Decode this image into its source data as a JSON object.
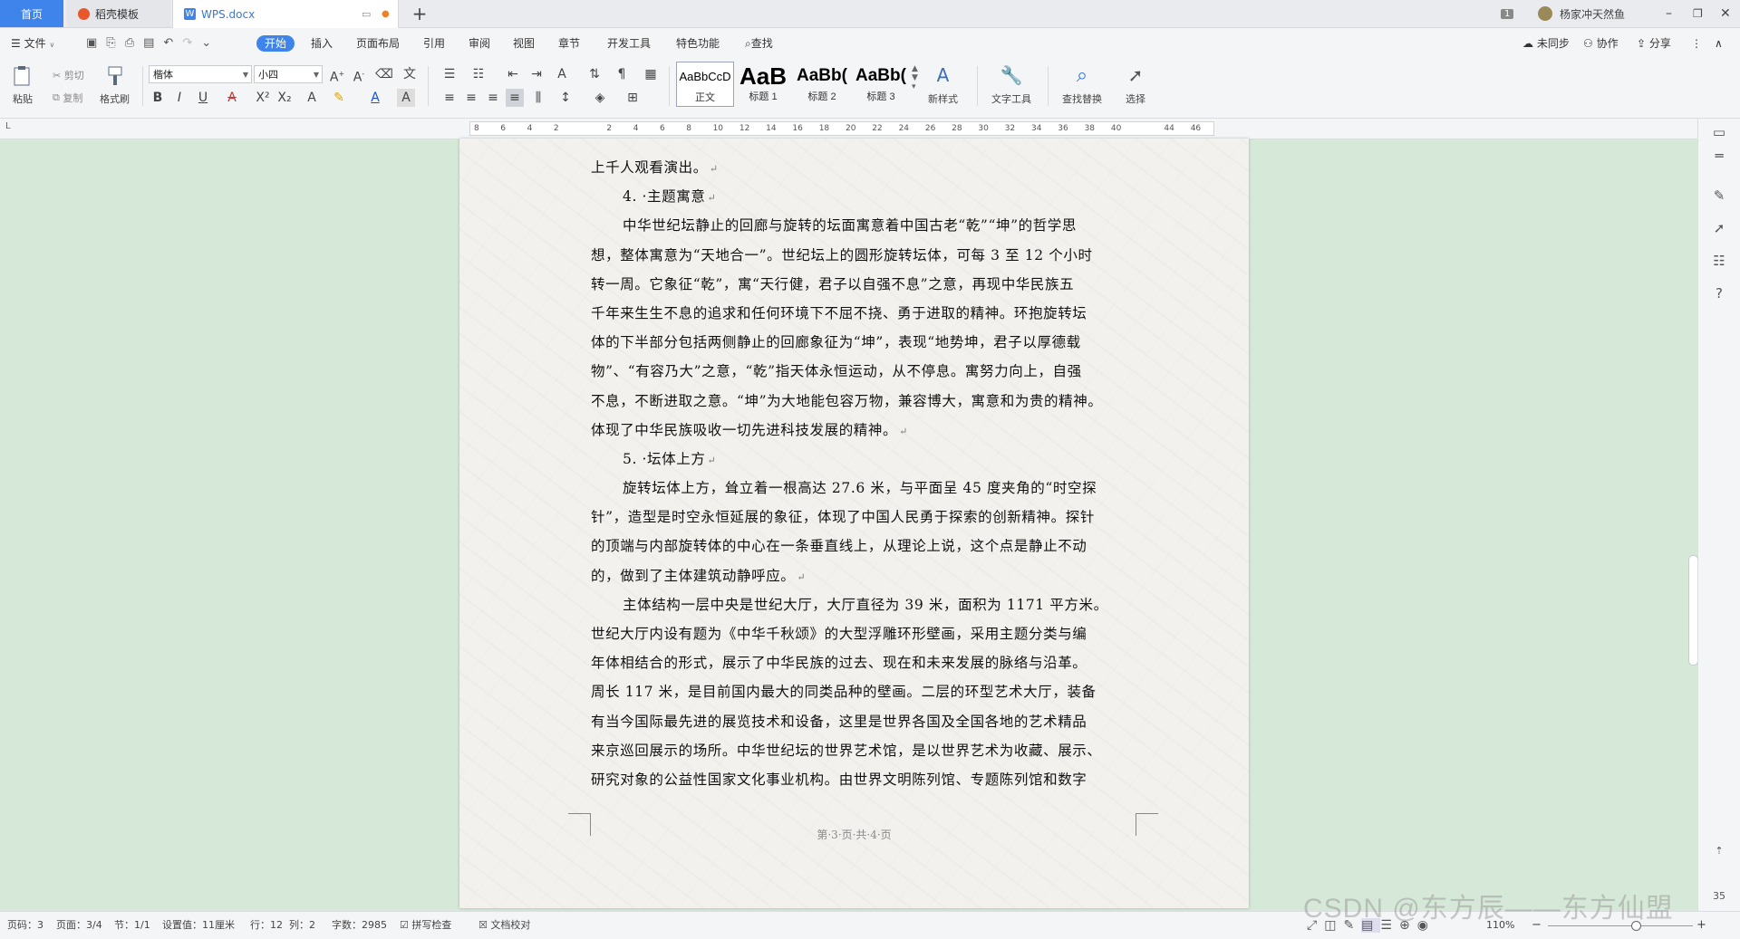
{
  "tabs": {
    "home": "首页",
    "template": "稻壳模板",
    "doc": "WPS.docx",
    "new_tab": "+"
  },
  "window": {
    "badge": "1",
    "user": "杨家冲天然鱼"
  },
  "menu": {
    "file": "文件",
    "items": [
      "开始",
      "插入",
      "页面布局",
      "引用",
      "审阅",
      "视图",
      "章节",
      "开发工具",
      "特色功能"
    ],
    "search": "查找",
    "sync": "未同步",
    "collab": "协作",
    "share": "分享"
  },
  "ribbon": {
    "paste": "粘贴",
    "cut": "剪切",
    "copy": "复制",
    "format_painter": "格式刷",
    "font_name": "楷体",
    "font_size": "小四",
    "styles": [
      {
        "sample": "AaBbCcD",
        "name": "正文"
      },
      {
        "sample": "AaB",
        "name": "标题 1"
      },
      {
        "sample": "AaBb(",
        "name": "标题 2"
      },
      {
        "sample": "AaBb(",
        "name": "标题 3"
      }
    ],
    "new_style": "新样式",
    "text_tools": "文字工具",
    "find_replace": "查找替换",
    "select": "选择"
  },
  "ruler": {
    "ticks": [
      "8",
      "6",
      "4",
      "2",
      "",
      "2",
      "4",
      "6",
      "8",
      "10",
      "12",
      "14",
      "16",
      "18",
      "20",
      "22",
      "24",
      "26",
      "28",
      "30",
      "32",
      "34",
      "36",
      "38",
      "40",
      "",
      "44",
      "46"
    ]
  },
  "document": {
    "lines": [
      {
        "text": "上千人观看演出。",
        "indent": false,
        "mark": true
      },
      {
        "text": "4. ·主题寓意",
        "indent": true,
        "mark": true
      },
      {
        "text": "中华世纪坛静止的回廊与旋转的坛面寓意着中国古老“乾”“坤”的哲学思",
        "indent": true,
        "mark": false
      },
      {
        "text": "想，整体寓意为“天地合一”。世纪坛上的圆形旋转坛体，可每 3 至 12 个小时",
        "indent": false,
        "mark": false
      },
      {
        "text": "转一周。它象征“乾”，寓“天行健，君子以自强不息”之意，再现中华民族五",
        "indent": false,
        "mark": false
      },
      {
        "text": "千年来生生不息的追求和任何环境下不屈不挠、勇于进取的精神。环抱旋转坛",
        "indent": false,
        "mark": false
      },
      {
        "text": "体的下半部分包括两侧静止的回廊象征为“坤”，表现“地势坤，君子以厚德载",
        "indent": false,
        "mark": false
      },
      {
        "text": "物”、“有容乃大”之意，“乾”指天体永恒运动，从不停息。寓努力向上，自强",
        "indent": false,
        "mark": false
      },
      {
        "text": "不息，不断进取之意。“坤”为大地能包容万物，兼容博大，寓意和为贵的精神。",
        "indent": false,
        "mark": false
      },
      {
        "text": "体现了中华民族吸收一切先进科技发展的精神。",
        "indent": false,
        "mark": true
      },
      {
        "text": "5. ·坛体上方",
        "indent": true,
        "mark": true
      },
      {
        "text": "旋转坛体上方，耸立着一根高达 27.6 米，与平面呈 45 度夹角的“时空探",
        "indent": true,
        "mark": false
      },
      {
        "text": "针”，造型是时空永恒延展的象征，体现了中国人民勇于探索的创新精神。探针",
        "indent": false,
        "mark": false
      },
      {
        "text": "的顶端与内部旋转体的中心在一条垂直线上，从理论上说，这个点是静止不动",
        "indent": false,
        "mark": false
      },
      {
        "text": "的，做到了主体建筑动静呼应。",
        "indent": false,
        "mark": true
      },
      {
        "text": "主体结构一层中央是世纪大厅，大厅直径为 39 米，面积为 1171 平方米。",
        "indent": true,
        "mark": false
      },
      {
        "text": "世纪大厅内设有题为《中华千秋颂》的大型浮雕环形壁画，采用主题分类与编",
        "indent": false,
        "mark": false
      },
      {
        "text": "年体相结合的形式，展示了中华民族的过去、现在和未来发展的脉络与沿革。",
        "indent": false,
        "mark": false
      },
      {
        "text": "周长 117 米，是目前国内最大的同类品种的壁画。二层的环型艺术大厅，装备",
        "indent": false,
        "mark": false
      },
      {
        "text": "有当今国际最先进的展览技术和设备，这里是世界各国及全国各地的艺术精品",
        "indent": false,
        "mark": false
      },
      {
        "text": "来京巡回展示的场所。中华世纪坛的世界艺术馆，是以世界艺术为收藏、展示、",
        "indent": false,
        "mark": false
      },
      {
        "text": "研究对象的公益性国家文化事业机构。由世界文明陈列馆、专题陈列馆和数字",
        "indent": false,
        "mark": false
      }
    ],
    "paragraph_mark": "↵",
    "footer": "第·3·页·共·4·页"
  },
  "status": {
    "page_code": "页码：3",
    "page": "页面：3/4",
    "section": "节：1/1",
    "setting": "设置值：11厘米",
    "row": "行：12",
    "col": "列：2",
    "word_count": "字数：2985",
    "spell_check": "拼写检查",
    "doc_proof": "文档校对",
    "zoom": "110%",
    "zoom_level": 1.1
  },
  "watermark": "CSDN @东方辰——东方仙盟",
  "side": {
    "num": "35"
  },
  "colors": {
    "accent": "#3e84ea",
    "canvas": "#d6e9d8",
    "paper": "#f3f1ee"
  }
}
